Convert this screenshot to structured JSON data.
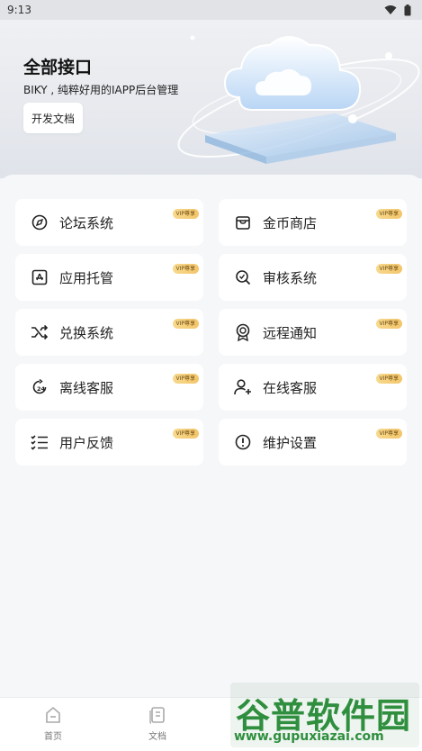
{
  "status_bar": {
    "time": "9:13"
  },
  "hero": {
    "title": "全部接口",
    "subtitle": "BIKY , 纯粹好用的IAPP后台管理",
    "doc_button_label": "开发文档"
  },
  "vip_badge": "VIP尊享",
  "grid": [
    {
      "label": "论坛系统",
      "icon": "compass-icon"
    },
    {
      "label": "金币商店",
      "icon": "storefront-icon"
    },
    {
      "label": "应用托管",
      "icon": "app-hosting-icon"
    },
    {
      "label": "审核系统",
      "icon": "search-check-icon"
    },
    {
      "label": "兑换系统",
      "icon": "shuffle-icon"
    },
    {
      "label": "远程通知",
      "icon": "badge-icon"
    },
    {
      "label": "离线客服",
      "icon": "clock-24-icon"
    },
    {
      "label": "在线客服",
      "icon": "user-plus-icon"
    },
    {
      "label": "用户反馈",
      "icon": "checklist-icon"
    },
    {
      "label": "维护设置",
      "icon": "alert-circle-icon"
    }
  ],
  "tabbar": {
    "home_label": "首页",
    "docs_label": "文档"
  },
  "watermark": {
    "title": "谷普软件园",
    "url": "www.gupuxiazai.com"
  }
}
